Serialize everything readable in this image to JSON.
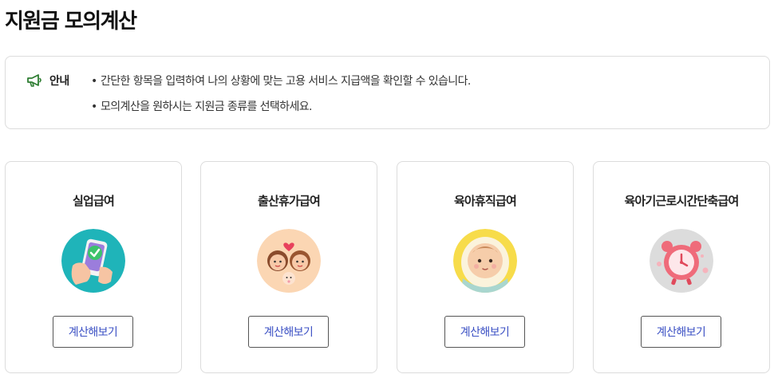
{
  "page": {
    "title": "지원금 모의계산"
  },
  "notice": {
    "label": "안내",
    "icon": "megaphone-icon",
    "lines": [
      "간단한 항목을 입력하여 나의 상황에 맞는 고용 서비스 지급액을 확인할 수 있습니다.",
      "모의계산을 원하시는 지원금 종류를 선택하세요."
    ],
    "bullet": "•"
  },
  "cards": [
    {
      "title": "실업급여",
      "button": "계산해보기",
      "icon": "phone-check-hand-icon",
      "bg_color": "#1fb4b9"
    },
    {
      "title": "출산휴가급여",
      "button": "계산해보기",
      "icon": "parents-baby-heart-icon",
      "bg_color": "#fbd6b3"
    },
    {
      "title": "육아휴직급여",
      "button": "계산해보기",
      "icon": "baby-face-icon",
      "bg_color": "#f7dc4a"
    },
    {
      "title": "육아기근로시간단축급여",
      "button": "계산해보기",
      "icon": "alarm-clock-icon",
      "bg_color": "#dcdcdc"
    }
  ],
  "colors": {
    "accent": "#3b50c4",
    "notice_icon": "#2e7d32",
    "border": "#dcdcdc"
  }
}
